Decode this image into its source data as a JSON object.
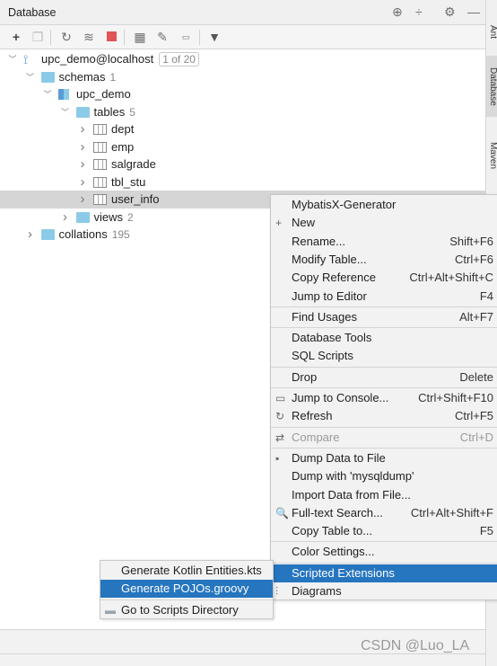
{
  "header": {
    "title": "Database",
    "icons": [
      "crosshair-icon",
      "collapse-icon",
      "gear-icon",
      "minimize-icon"
    ]
  },
  "toolbar": {
    "icons": [
      "add-icon",
      "duplicate-icon",
      "refresh-icon",
      "schema-tools-icon",
      "stop-icon",
      "table-icon",
      "edit-icon",
      "console-icon",
      "filter-icon"
    ],
    "stop_color": "#e05555"
  },
  "side_tabs": [
    "Ant",
    "Database",
    "Maven"
  ],
  "tree": [
    {
      "label": "upc_demo@localhost",
      "badge": "1 of 20",
      "level": 0,
      "icon": "mysql-icon",
      "expanded": true
    },
    {
      "label": "schemas",
      "count": "1",
      "level": 1,
      "icon": "folder-icon",
      "expanded": true
    },
    {
      "label": "upc_demo",
      "level": 2,
      "icon": "schema-icon",
      "expanded": true
    },
    {
      "label": "tables",
      "count": "5",
      "level": 3,
      "icon": "folder-icon",
      "expanded": true
    },
    {
      "label": "dept",
      "level": 4,
      "icon": "table-icon"
    },
    {
      "label": "emp",
      "level": 4,
      "icon": "table-icon"
    },
    {
      "label": "salgrade",
      "level": 4,
      "icon": "table-icon"
    },
    {
      "label": "tbl_stu",
      "level": 4,
      "icon": "table-icon"
    },
    {
      "label": "user_info",
      "level": 4,
      "icon": "table-icon",
      "selected": true
    },
    {
      "label": "views",
      "count": "2",
      "level": 3,
      "icon": "folder-icon"
    },
    {
      "label": "collations",
      "count": "195",
      "level": 1,
      "icon": "folder-icon"
    }
  ],
  "context_menu": [
    {
      "label": "MybatisX-Generator"
    },
    {
      "label": "New",
      "icon": "plus-icon",
      "submenu": true
    },
    {
      "label": "Rename...",
      "shortcut": "Shift+F6"
    },
    {
      "label": "Modify Table...",
      "shortcut": "Ctrl+F6"
    },
    {
      "label": "Copy Reference",
      "shortcut": "Ctrl+Alt+Shift+C"
    },
    {
      "label": "Jump to Editor",
      "shortcut": "F4"
    },
    {
      "sep": true
    },
    {
      "label": "Find Usages",
      "shortcut": "Alt+F7"
    },
    {
      "sep": true
    },
    {
      "label": "Database Tools",
      "submenu": true
    },
    {
      "label": "SQL Scripts",
      "submenu": true
    },
    {
      "sep": true
    },
    {
      "label": "Drop",
      "shortcut": "Delete"
    },
    {
      "sep": true
    },
    {
      "label": "Jump to Console...",
      "shortcut": "Ctrl+Shift+F10",
      "icon": "console-icon"
    },
    {
      "label": "Refresh",
      "shortcut": "Ctrl+F5",
      "icon": "refresh-icon"
    },
    {
      "sep": true
    },
    {
      "label": "Compare",
      "shortcut": "Ctrl+D",
      "icon": "compare-icon",
      "disabled": true
    },
    {
      "sep": true
    },
    {
      "label": "Dump Data to File",
      "icon": "save-icon",
      "submenu": true
    },
    {
      "label": "Dump with 'mysqldump'"
    },
    {
      "label": "Import Data from File..."
    },
    {
      "label": "Full-text Search...",
      "shortcut": "Ctrl+Alt+Shift+F",
      "icon": "search-icon"
    },
    {
      "label": "Copy Table to...",
      "shortcut": "F5"
    },
    {
      "sep": true
    },
    {
      "label": "Color Settings..."
    },
    {
      "sep": true
    },
    {
      "label": "Scripted Extensions",
      "submenu": true,
      "highlighted": true
    },
    {
      "label": "Diagrams",
      "icon": "diagram-icon",
      "submenu": true
    }
  ],
  "submenu": [
    {
      "label": "Generate Kotlin Entities.kts"
    },
    {
      "label": "Generate POJOs.groovy",
      "highlighted": true
    },
    {
      "sep": true
    },
    {
      "label": "Go to Scripts Directory",
      "icon": "folder-icon"
    }
  ],
  "watermark": "CSDN @Luo_LA",
  "colors": {
    "highlight": "#2675bf",
    "folder": "#8ccbe8",
    "selection": "#d5d5d5"
  }
}
